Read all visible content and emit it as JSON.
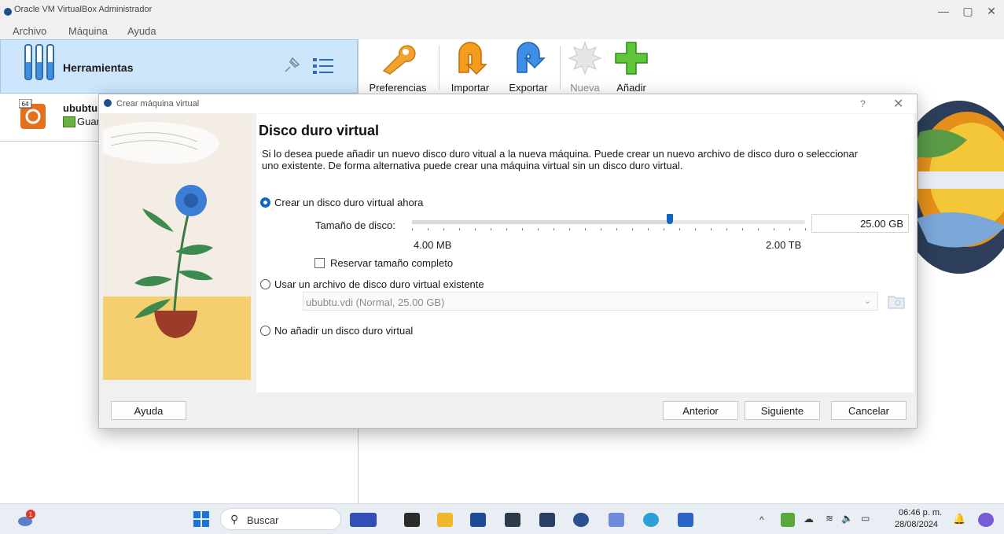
{
  "window": {
    "title": "Oracle VM VirtualBox Administrador",
    "controls": [
      "—",
      "▢",
      "✕"
    ],
    "menu": [
      "Archivo",
      "Máquina",
      "Ayuda"
    ]
  },
  "sidebar": {
    "tools_label": "Herramientas",
    "vm": {
      "os_badge": "64",
      "name": "ububtu",
      "state": "Guardada"
    }
  },
  "toolbar": {
    "items": [
      {
        "label": "Preferencias",
        "icon": "wrench-icon",
        "enabled": true
      },
      {
        "label": "Importar",
        "icon": "import-arrow-icon",
        "enabled": true
      },
      {
        "label": "Exportar",
        "icon": "export-arrow-icon",
        "enabled": true
      },
      {
        "label": "Nueva",
        "icon": "new-machine-icon",
        "enabled": false
      },
      {
        "label": "Añadir",
        "icon": "add-plus-icon",
        "enabled": true
      }
    ]
  },
  "dialog": {
    "title": "Crear máquina virtual",
    "help_glyph": "?",
    "close_glyph": "✕",
    "heading": "Disco duro virtual",
    "description": "Si lo desea puede añadir un nuevo disco duro vitual a la nueva máquina. Puede crear un nuevo archivo de disco duro o seleccionar uno existente. De forma alternativa puede crear una máquina virtual sin un disco duro virtual.",
    "options": [
      {
        "label": "Crear un disco duro virtual ahora",
        "selected": true
      },
      {
        "label": "Usar un archivo de disco duro virtual existente",
        "selected": false
      },
      {
        "label": "No añadir un disco duro virtual",
        "selected": false
      }
    ],
    "disk_size": {
      "label": "Tamaño de disco:",
      "value": "25.00 GB",
      "min_label": "4.00 MB",
      "max_label": "2.00 TB",
      "slider_fraction": 0.655,
      "tick_count": 26
    },
    "preallocate": {
      "label": "Reservar tamaño completo",
      "checked": false
    },
    "existing_disk": {
      "value": "ububtu.vdi (Normal, 25.00 GB)"
    },
    "buttons": {
      "help": "Ayuda",
      "back": "Anterior",
      "next": "Siguiente",
      "cancel": "Cancelar"
    }
  },
  "taskbar": {
    "search_label": "Buscar",
    "weather_badge": "1",
    "time": "06:46 p. m.",
    "date": "28/08/2024"
  }
}
